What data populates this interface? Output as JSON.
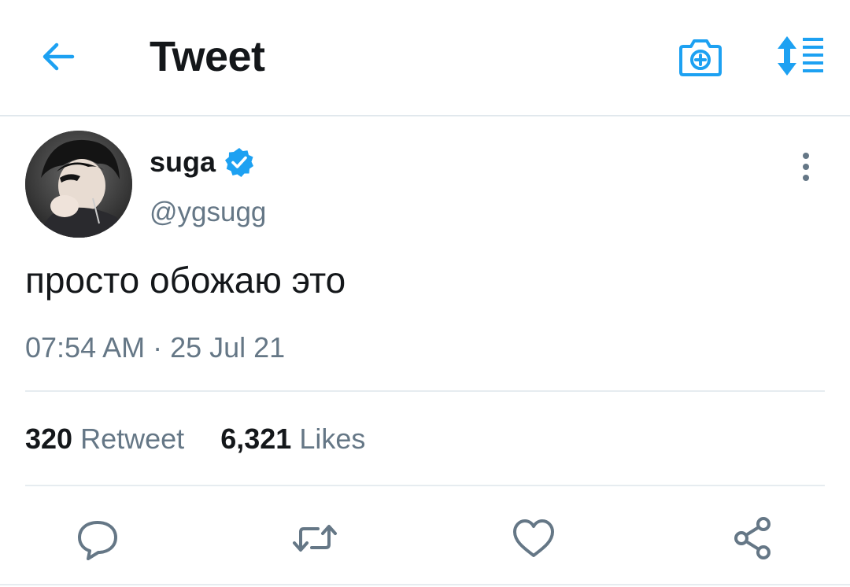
{
  "header": {
    "title": "Tweet",
    "back_icon": "arrow-left-icon",
    "camera_icon": "camera-plus-icon",
    "sort_icon": "sort-list-icon",
    "accent_color": "#1da1f2"
  },
  "tweet": {
    "display_name": "suga",
    "verified_icon": "verified-badge-icon",
    "handle": "@ygsugg",
    "text": "просто обожаю это",
    "timestamp": "07:54 AM · 25 Jul 21",
    "more_icon": "more-vertical-icon"
  },
  "stats": {
    "retweet_count": "320",
    "retweet_label": "Retweet",
    "likes_count": "6,321",
    "likes_label": "Likes"
  },
  "actions": {
    "reply_icon": "reply-icon",
    "retweet_icon": "retweet-icon",
    "like_icon": "heart-icon",
    "share_icon": "share-icon",
    "icon_color": "#657786"
  }
}
